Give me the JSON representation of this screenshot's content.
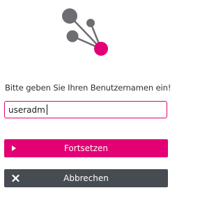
{
  "login": {
    "prompt": "Bitte geben Sie Ihren Benutzernamen ein!",
    "username_value": "useradm",
    "continue_label": "Fortsetzen",
    "cancel_label": "Abbrechen"
  },
  "icons": {
    "logo": "network-nodes-logo",
    "continue": "play-arrow-icon",
    "cancel": "close-x-icon"
  },
  "colors": {
    "accent": "#e20074",
    "node_gray": "#6d6e71",
    "cancel_bg": "#474c53"
  }
}
